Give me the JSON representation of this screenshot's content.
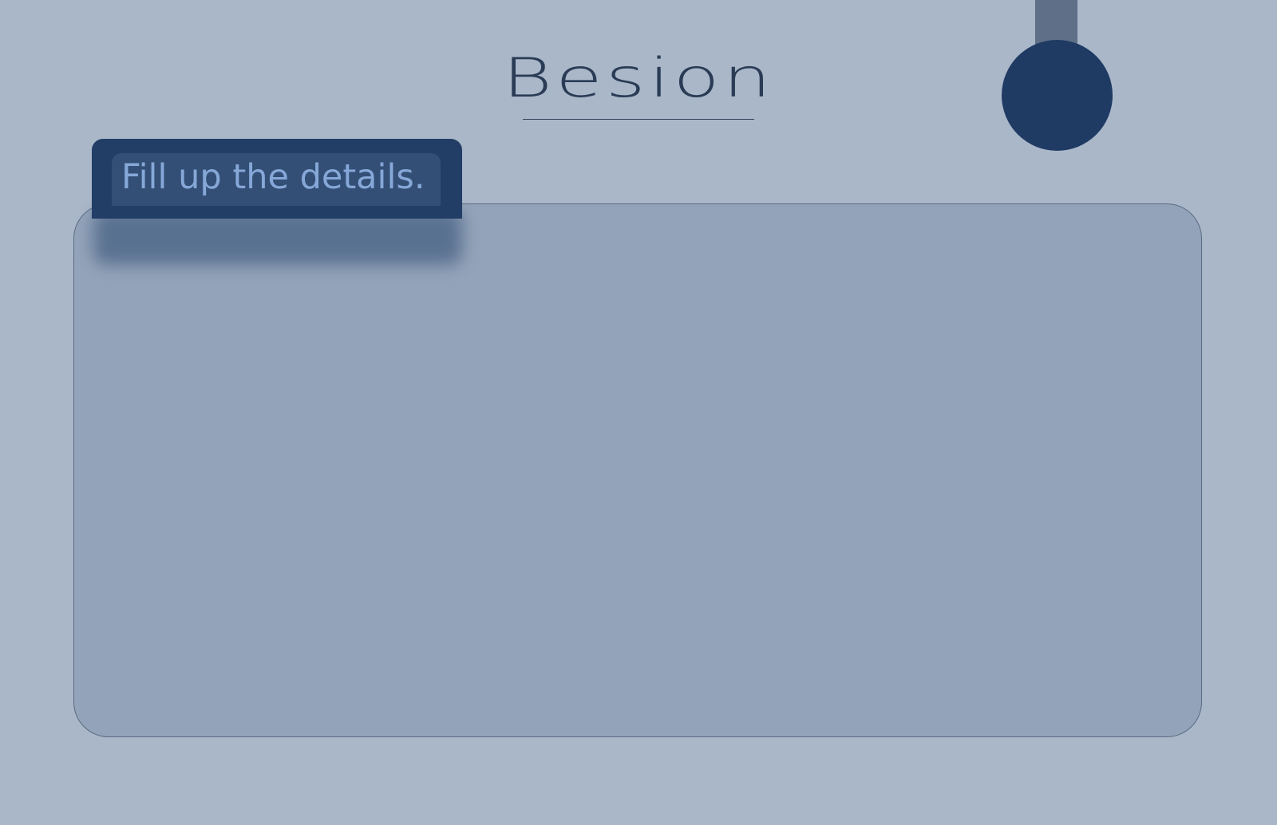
{
  "brand": {
    "name": "Besion"
  },
  "tab": {
    "title": "Fill up the details."
  },
  "colors": {
    "background": "#aab7c9",
    "accent": "#223e66",
    "accent_light": "#86a8d8",
    "panel": "#93a3b9",
    "brand_text": "#2a3c55"
  },
  "decorations": {
    "pendant": "hanging-circle"
  }
}
